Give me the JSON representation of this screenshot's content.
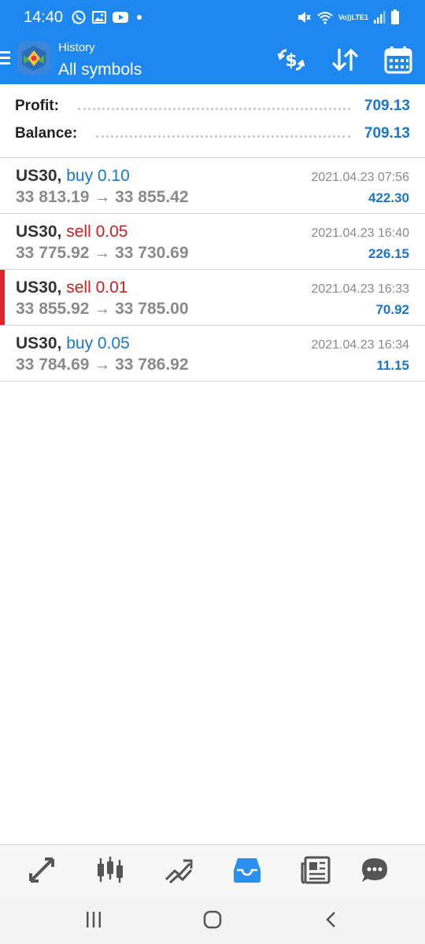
{
  "status_bar": {
    "time": "14:40",
    "left_icons": [
      "whatsapp-icon",
      "gallery-icon",
      "youtube-icon",
      "dot-icon"
    ],
    "right_icons": [
      "mute-icon",
      "wifi-icon",
      "volte-lte-icon",
      "signal-icon",
      "battery-icon"
    ],
    "volte_label": "Vo))",
    "lte_label": "LTE1"
  },
  "app_bar": {
    "subtitle": "History",
    "title": "All symbols",
    "actions": [
      "deposit-withdraw-icon",
      "sort-icon",
      "calendar-icon"
    ],
    "color": "#1e88f0"
  },
  "summary": {
    "profit_label": "Profit:",
    "profit_value": "709.13",
    "balance_label": "Balance:",
    "balance_value": "709.13"
  },
  "deals": [
    {
      "symbol": "US30,",
      "type": "buy 0.10",
      "side": "buy",
      "prices": "33 813.19 → 33 855.42",
      "time": "2021.04.23 07:56",
      "profit": "422.30",
      "marked": false
    },
    {
      "symbol": "US30,",
      "type": "sell 0.05",
      "side": "sell",
      "prices": "33 775.92 → 33 730.69",
      "time": "2021.04.23 16:40",
      "profit": "226.15",
      "marked": false
    },
    {
      "symbol": "US30,",
      "type": "sell 0.01",
      "side": "sell",
      "prices": "33 855.92 → 33 785.00",
      "time": "2021.04.23 16:33",
      "profit": "70.92",
      "marked": true
    },
    {
      "symbol": "US30,",
      "type": "buy 0.05",
      "side": "buy",
      "prices": "33 784.69 → 33 786.92",
      "time": "2021.04.23 16:34",
      "profit": "11.15",
      "marked": false
    }
  ],
  "bottom_nav": {
    "items": [
      "quotes-icon",
      "chart-icon",
      "trade-icon",
      "history-icon",
      "news-icon",
      "chat-icon"
    ],
    "active": "history-icon",
    "active_color": "#2b8ff0",
    "inactive_color": "#555555"
  },
  "system_nav": [
    "recents-icon",
    "home-icon",
    "back-icon"
  ]
}
